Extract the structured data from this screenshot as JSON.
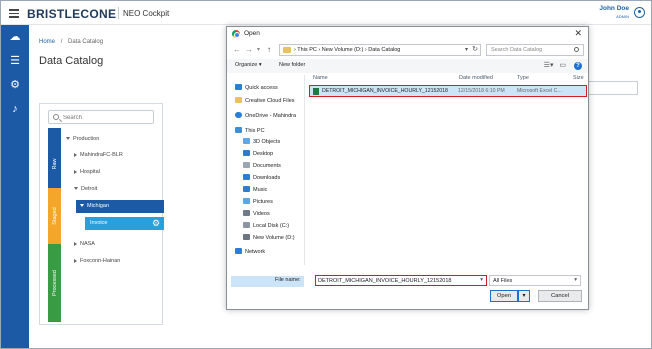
{
  "header": {
    "brand": "BRISTLECONE",
    "product": "NEO Cockpit",
    "user_name": "John Doe",
    "user_role": "ADMIN"
  },
  "rail": {
    "icons": [
      "cloud-icon",
      "sliders-icon",
      "settings-icon",
      "bell-icon"
    ]
  },
  "breadcrumb": {
    "home": "Home",
    "sep": "/",
    "current": "Data Catalog"
  },
  "page_title": "Data Catalog",
  "tree": {
    "search_placeholder": "Search",
    "stages": {
      "raw": "Raw",
      "staged": "Staged",
      "processed": "Processed"
    },
    "nodes": {
      "production": "Production",
      "mahindra": "MahindraFC-BLR",
      "hospital": "Hospital",
      "detroit": "Detroit",
      "michigan": "Michigan",
      "invoice": "Invoice",
      "nasa": "NASA",
      "foxconn": "Foxconn-Hainan"
    }
  },
  "dialog": {
    "title": "Open",
    "address": {
      "p1": "This PC",
      "p2": "New Volume (D:)",
      "p3": "Data Catalog"
    },
    "search_placeholder": "Search Data Catalog",
    "organize": "Organize ▾",
    "new_folder": "New folder",
    "nav": {
      "quick_access": "Quick access",
      "creative_cloud": "Creative Cloud Files",
      "onedrive": "OneDrive - Mahindra",
      "this_pc": "This PC",
      "objects3d": "3D Objects",
      "desktop": "Desktop",
      "documents": "Documents",
      "downloads": "Downloads",
      "music": "Music",
      "pictures": "Pictures",
      "videos": "Videos",
      "local_disk": "Local Disk (C:)",
      "new_volume": "New Volume (D:)",
      "network": "Network"
    },
    "columns": {
      "name": "Name",
      "date": "Date modified",
      "type": "Type",
      "size": "Size"
    },
    "file": {
      "name": "DETROIT_MICHIGAN_INVOICE_HOURLY_12152018",
      "date": "12/15/2018 6:10 PM",
      "type": "Microsoft Excel C..."
    },
    "file_name_label": "File name:",
    "file_name_value": "DETROIT_MICHIGAN_INVOICE_HOURLY_12152018",
    "file_type": "All Files",
    "open_label": "Open",
    "cancel_label": "Cancel"
  },
  "colors": {
    "brand_blue": "#1d5aa6",
    "invoice_blue": "#2b9fdc",
    "staged_orange": "#f3a62a",
    "processed_green": "#3a9b45",
    "highlight_red": "#d81b23"
  }
}
